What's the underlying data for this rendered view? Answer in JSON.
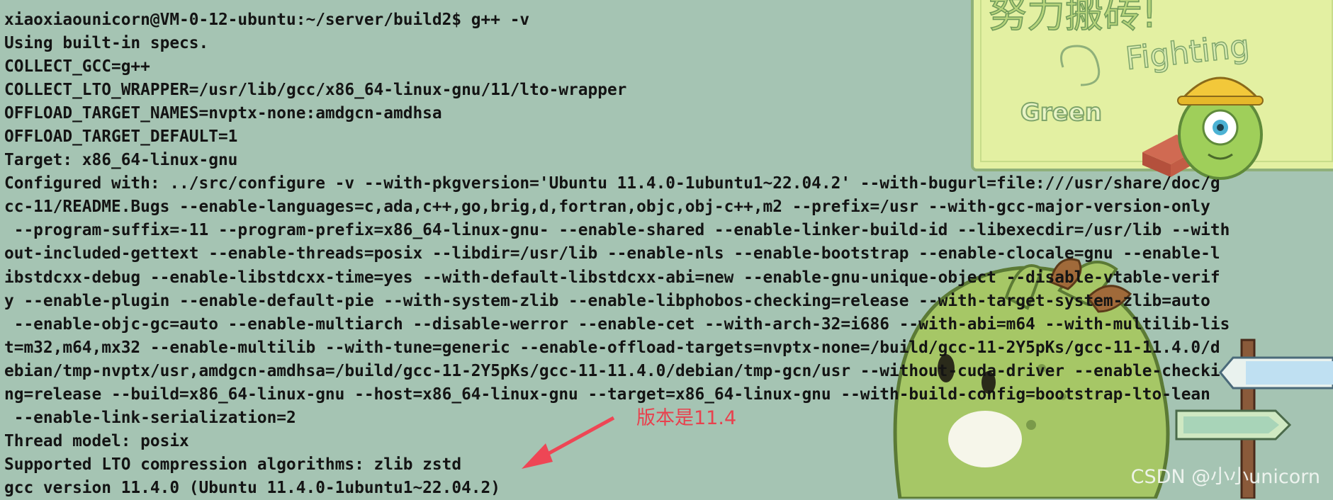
{
  "terminal": {
    "lines": [
      "xiaoxiaounicorn@VM-0-12-ubuntu:~/server/build2$ g++ -v",
      "Using built-in specs.",
      "COLLECT_GCC=g++",
      "COLLECT_LTO_WRAPPER=/usr/lib/gcc/x86_64-linux-gnu/11/lto-wrapper",
      "OFFLOAD_TARGET_NAMES=nvptx-none:amdgcn-amdhsa",
      "OFFLOAD_TARGET_DEFAULT=1",
      "Target: x86_64-linux-gnu",
      "Configured with: ../src/configure -v --with-pkgversion='Ubuntu 11.4.0-1ubuntu1~22.04.2' --with-bugurl=file:///usr/share/doc/g",
      "cc-11/README.Bugs --enable-languages=c,ada,c++,go,brig,d,fortran,objc,obj-c++,m2 --prefix=/usr --with-gcc-major-version-only",
      " --program-suffix=-11 --program-prefix=x86_64-linux-gnu- --enable-shared --enable-linker-build-id --libexecdir=/usr/lib --with",
      "out-included-gettext --enable-threads=posix --libdir=/usr/lib --enable-nls --enable-bootstrap --enable-clocale=gnu --enable-l",
      "ibstdcxx-debug --enable-libstdcxx-time=yes --with-default-libstdcxx-abi=new --enable-gnu-unique-object --disable-vtable-verif",
      "y --enable-plugin --enable-default-pie --with-system-zlib --enable-libphobos-checking=release --with-target-system-zlib=auto",
      " --enable-objc-gc=auto --enable-multiarch --disable-werror --enable-cet --with-arch-32=i686 --with-abi=m64 --with-multilib-lis",
      "t=m32,m64,mx32 --enable-multilib --with-tune=generic --enable-offload-targets=nvptx-none=/build/gcc-11-2Y5pKs/gcc-11-11.4.0/d",
      "ebian/tmp-nvptx/usr,amdgcn-amdhsa=/build/gcc-11-2Y5pKs/gcc-11-11.4.0/debian/tmp-gcn/usr --without-cuda-driver --enable-checki",
      "ng=release --build=x86_64-linux-gnu --host=x86_64-linux-gnu --target=x86_64-linux-gnu --with-build-config=bootstrap-lto-lean",
      " --enable-link-serialization=2",
      "Thread model: posix",
      "Supported LTO compression algorithms: zlib zstd",
      "gcc version 11.4.0 (Ubuntu 11.4.0-1ubuntu1~22.04.2)"
    ]
  },
  "annotation": {
    "text": "版本是11.4",
    "color": "#e8414e"
  },
  "wallpaper": {
    "note_text": "努力搬砖!",
    "fighting_text": "Fighting",
    "green_text": "Green",
    "note_color": "#e3f0a2",
    "character_color": "#9fc45a"
  },
  "watermark": {
    "text": "CSDN @小小unicorn"
  }
}
